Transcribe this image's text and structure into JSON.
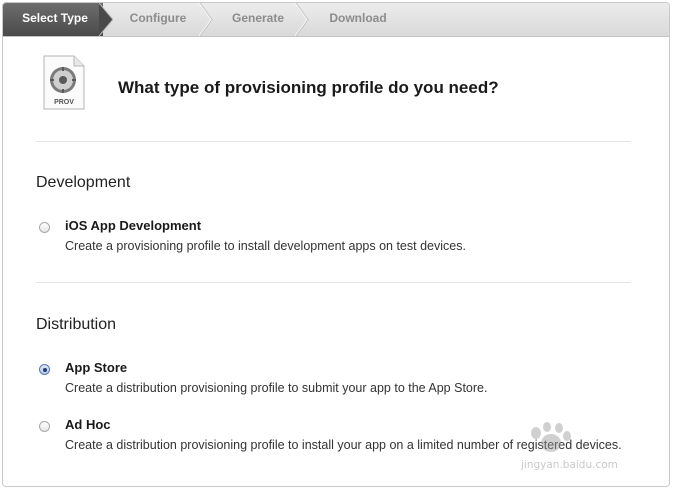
{
  "steps": [
    {
      "label": "Select Type",
      "active": true
    },
    {
      "label": "Configure",
      "active": false
    },
    {
      "label": "Generate",
      "active": false
    },
    {
      "label": "Download",
      "active": false
    }
  ],
  "header": {
    "icon_label": "PROV",
    "title": "What type of provisioning profile do you need?"
  },
  "development": {
    "title": "Development",
    "options": [
      {
        "label": "iOS App Development",
        "description": "Create a provisioning profile to install development apps on test devices.",
        "selected": false
      }
    ]
  },
  "distribution": {
    "title": "Distribution",
    "options": [
      {
        "label": "App Store",
        "description": "Create a distribution provisioning profile to submit your app to the App Store.",
        "selected": true
      },
      {
        "label": "Ad Hoc",
        "description": "Create a distribution provisioning profile to install your app on a limited number of registered devices.",
        "selected": false
      }
    ]
  },
  "watermark": {
    "text": "jingyan.baidu.com"
  },
  "colors": {
    "active_step_bg": "#4a4a4a",
    "step_bar_bg": "#dcdcdc",
    "radio_selected": "#1f3f73"
  }
}
